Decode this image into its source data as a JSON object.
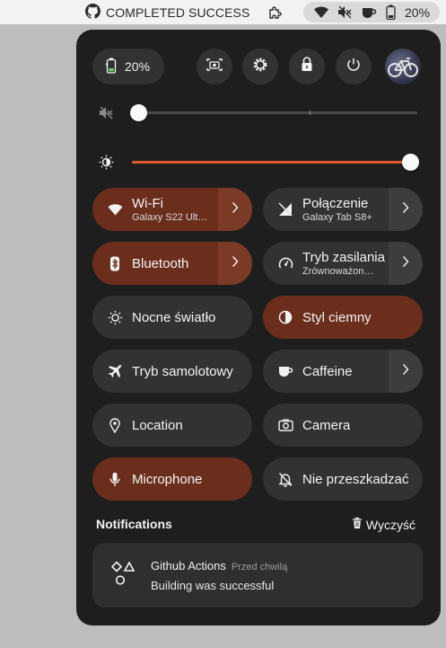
{
  "topbar": {
    "status_label": "COMPLETED SUCCESS",
    "battery_percent": "20%"
  },
  "panel": {
    "battery_percent": "20%",
    "volume": {
      "level": 0.0,
      "muted": true
    },
    "brightness": {
      "level": 1.0
    },
    "tiles": [
      {
        "title": "Wi-Fi",
        "subtitle": "Galaxy S22 Ult…",
        "active": true,
        "has_arrow": true,
        "icon": "wifi-icon"
      },
      {
        "title": "Połączenie",
        "subtitle": "Galaxy Tab S8+",
        "active": false,
        "has_arrow": true,
        "icon": "network-icon"
      },
      {
        "title": "Bluetooth",
        "subtitle": "",
        "active": true,
        "has_arrow": true,
        "icon": "bluetooth-icon"
      },
      {
        "title": "Tryb zasilania",
        "subtitle": "Zrównoważon…",
        "active": false,
        "has_arrow": true,
        "icon": "power-mode-icon"
      },
      {
        "title": "Nocne światło",
        "subtitle": "",
        "active": false,
        "has_arrow": false,
        "icon": "night-light-icon"
      },
      {
        "title": "Styl ciemny",
        "subtitle": "",
        "active": true,
        "has_arrow": false,
        "icon": "dark-style-icon"
      },
      {
        "title": "Tryb samolotowy",
        "subtitle": "",
        "active": false,
        "has_arrow": false,
        "icon": "airplane-icon"
      },
      {
        "title": "Caffeine",
        "subtitle": "",
        "active": false,
        "has_arrow": true,
        "icon": "coffee-icon"
      },
      {
        "title": "Location",
        "subtitle": "",
        "active": false,
        "has_arrow": false,
        "icon": "location-icon"
      },
      {
        "title": "Camera",
        "subtitle": "",
        "active": false,
        "has_arrow": false,
        "icon": "camera-icon"
      },
      {
        "title": "Microphone",
        "subtitle": "",
        "active": true,
        "has_arrow": false,
        "icon": "microphone-icon"
      },
      {
        "title": "Nie przeszkadzać",
        "subtitle": "",
        "active": false,
        "has_arrow": false,
        "icon": "bell-off-icon"
      }
    ],
    "notifications": {
      "heading": "Notifications",
      "clear_label": "Wyczyść",
      "items": [
        {
          "app": "Github Actions",
          "time": "Przed chwilą",
          "body": "Building was successful"
        }
      ]
    }
  },
  "colors": {
    "panel_bg": "#1e1e1e",
    "tile_bg": "#323232",
    "tile_active": "#6b2e1d",
    "accent": "#e05a30"
  }
}
